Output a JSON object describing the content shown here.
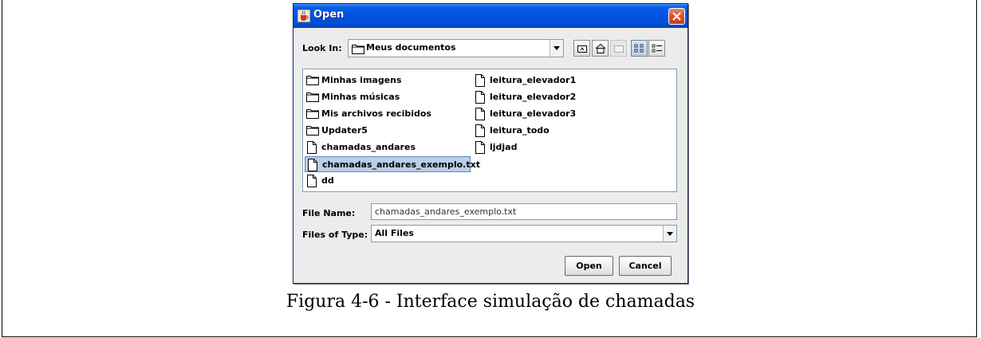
{
  "dialog": {
    "title": "Open",
    "look_in_label": "Look In:",
    "look_in_value": "Meus documentos",
    "file_name_label": "File Name:",
    "file_name_value": "chamadas_andares_exemplo.txt",
    "files_of_type_label": "Files of Type:",
    "files_of_type_value": "All Files",
    "open_button": "Open",
    "cancel_button": "Cancel"
  },
  "files": {
    "col1": [
      {
        "name": "Minhas imagens",
        "kind": "folder"
      },
      {
        "name": "Minhas músicas",
        "kind": "folder"
      },
      {
        "name": "Mis archivos recibidos",
        "kind": "folder"
      },
      {
        "name": "Updater5",
        "kind": "folder"
      },
      {
        "name": "chamadas_andares",
        "kind": "file"
      },
      {
        "name": "chamadas_andares_exemplo.txt",
        "kind": "file",
        "selected": true
      },
      {
        "name": "dd",
        "kind": "file"
      }
    ],
    "col2": [
      {
        "name": "leitura_elevador1",
        "kind": "file"
      },
      {
        "name": "leitura_elevador2",
        "kind": "file"
      },
      {
        "name": "leitura_elevador3",
        "kind": "file"
      },
      {
        "name": "leitura_todo",
        "kind": "file"
      },
      {
        "name": "ljdjad",
        "kind": "file"
      }
    ]
  },
  "caption": "Figura 4-6 - Interface simulação de chamadas",
  "colors": {
    "titlebar": "#0054e3",
    "dialog_bg": "#ececec",
    "selection": "#b8cfe5",
    "close_button": "#d8532c"
  }
}
